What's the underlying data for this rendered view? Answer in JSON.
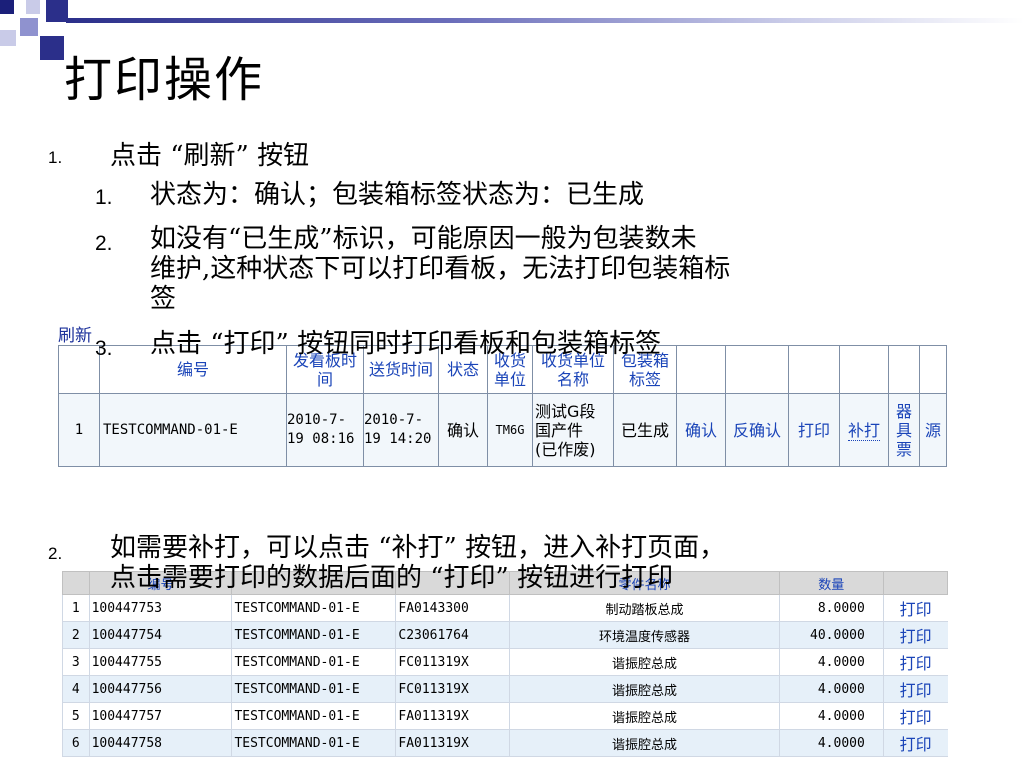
{
  "slide": {
    "title": "打印操作",
    "step1": {
      "num": "1.",
      "text": "点击 “刷新” 按钮",
      "subs": [
        {
          "num": "1.",
          "text": "状态为：确认；包装箱标签状态为：已生成"
        },
        {
          "num": "2.",
          "line1": "如没有“已生成”标识，可能原因一般为包装数未",
          "line2": "维护,这种状态下可以打印看板，无法打印包装箱标",
          "line3": "签"
        },
        {
          "num": "3.",
          "text": "点击 “打印” 按钮同时打印看板和包装箱标签"
        }
      ]
    },
    "step2": {
      "num": "2.",
      "line1": "如需要补打，可以点击 “补打” 按钮，进入补打页面，",
      "line2": "点击需要打印的数据后面的 “打印” 按钮进行打印"
    }
  },
  "table1": {
    "refresh_label": "刷新",
    "headers": [
      "编号",
      "发看板时间",
      "送货时间",
      "状态",
      "收货单位",
      "收货单位名称",
      "包装箱标签"
    ],
    "header_lines": {
      "send_time_1": "发看板时",
      "send_time_2": "间",
      "recv_unit_1": "收货",
      "recv_unit_2": "单位",
      "recv_name_1": "收货单位",
      "recv_name_2": "名称",
      "box_label_1": "包装箱",
      "box_label_2": "标签"
    },
    "row": {
      "index": "1",
      "code": "TESTCOMMAND-01-E",
      "kanban_date": "2010-7-",
      "kanban_time": "19 08:16",
      "delivery_date": "2010-7-",
      "delivery_time": "19 14:20",
      "status": "确认",
      "unit": "TM6G",
      "unit_name_1": "测试G段",
      "unit_name_2": "国产件",
      "unit_name_3": "(已作废)",
      "box_status": "已生成",
      "confirm": "确认",
      "unconfirm": "反确认",
      "print": "打印",
      "reprint": "补打",
      "tool_1": "器",
      "tool_2": "具",
      "tool_3": "票",
      "source": "源"
    }
  },
  "table2": {
    "headers": [
      "",
      "",
      "编号",
      "",
      "零件名称",
      "",
      "数量",
      ""
    ],
    "rows": [
      {
        "i": "1",
        "id": "100447753",
        "cmd": "TESTCOMMAND-01-E",
        "part": "FA0143300",
        "name": "制动踏板总成",
        "qty": "8.0000",
        "action": "打印"
      },
      {
        "i": "2",
        "id": "100447754",
        "cmd": "TESTCOMMAND-01-E",
        "part": "C23061764",
        "name": "环境温度传感器",
        "qty": "40.0000",
        "action": "打印"
      },
      {
        "i": "3",
        "id": "100447755",
        "cmd": "TESTCOMMAND-01-E",
        "part": "FC011319X",
        "name": "谐振腔总成",
        "qty": "4.0000",
        "action": "打印"
      },
      {
        "i": "4",
        "id": "100447756",
        "cmd": "TESTCOMMAND-01-E",
        "part": "FC011319X",
        "name": "谐振腔总成",
        "qty": "4.0000",
        "action": "打印"
      },
      {
        "i": "5",
        "id": "100447757",
        "cmd": "TESTCOMMAND-01-E",
        "part": "FA011319X",
        "name": "谐振腔总成",
        "qty": "4.0000",
        "action": "打印"
      },
      {
        "i": "6",
        "id": "100447758",
        "cmd": "TESTCOMMAND-01-E",
        "part": "FA011319X",
        "name": "谐振腔总成",
        "qty": "4.0000",
        "action": "打印"
      }
    ]
  },
  "colors": {
    "link": "#1a44b8",
    "header_bar": "#2b2f8a"
  }
}
